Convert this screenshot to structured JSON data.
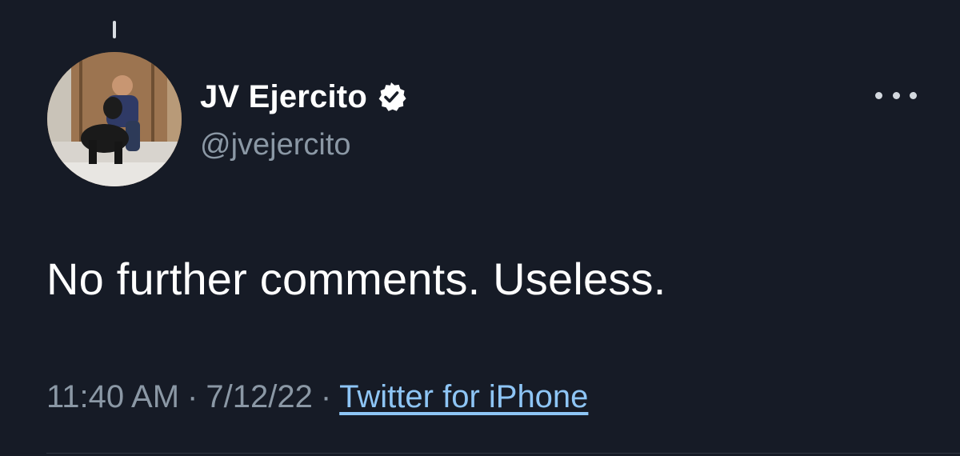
{
  "tweet": {
    "author": {
      "display_name": "JV Ejercito",
      "handle": "@jvejercito",
      "verified": true,
      "avatar_icon": "avatar-photo-man-with-dog"
    },
    "text": "No further comments. Useless.",
    "meta": {
      "time": "11:40 AM",
      "separator": "·",
      "date": "7/12/22",
      "source": "Twitter for iPhone"
    },
    "more_icon": "more-horizontal-icon"
  },
  "colors": {
    "background": "#161b26",
    "primary_text": "#ffffff",
    "secondary_text": "#8b98a5",
    "link": "#8ec5f5",
    "verified_badge": "#ffffff"
  }
}
